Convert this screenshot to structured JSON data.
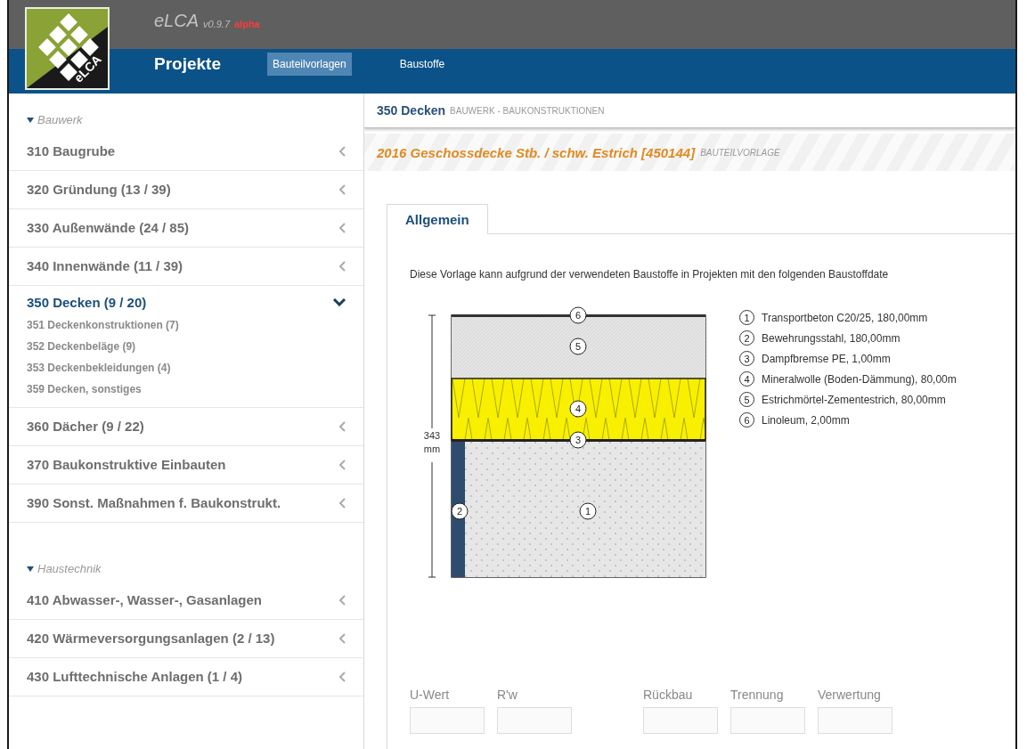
{
  "app": {
    "logo_text": "eLCA",
    "name": "eLCA",
    "version": "v0.9.7",
    "stage": "alpha"
  },
  "nav": {
    "title": "Projekte",
    "tabs": [
      {
        "label": "Bauteilvorlagen",
        "selected": true
      },
      {
        "label": "Baustoffe",
        "selected": false
      }
    ]
  },
  "sidebar": {
    "groups": [
      {
        "title": "Bauwerk",
        "expanded": true,
        "items": [
          {
            "label": "310 Baugrube",
            "expanded": false
          },
          {
            "label": "320 Gründung (13 / 39)",
            "expanded": false
          },
          {
            "label": "330 Außenwände (24 / 85)",
            "expanded": false
          },
          {
            "label": "340 Innenwände (11 / 39)",
            "expanded": false
          },
          {
            "label": "350 Decken (9 / 20)",
            "expanded": true,
            "children": [
              {
                "label": "351 Deckenkonstruktionen (7)"
              },
              {
                "label": "352 Deckenbeläge (9)"
              },
              {
                "label": "353 Deckenbekleidungen (4)"
              },
              {
                "label": "359 Decken, sonstiges"
              }
            ]
          },
          {
            "label": "360 Dächer (9 / 22)",
            "expanded": false
          },
          {
            "label": "370 Baukonstruktive Einbauten",
            "expanded": false
          },
          {
            "label": "390 Sonst. Maßnahmen f. Baukonstrukt.",
            "expanded": false
          }
        ]
      },
      {
        "title": "Haustechnik",
        "expanded": true,
        "items": [
          {
            "label": "410 Abwasser-, Wasser-, Gasanlagen",
            "expanded": false
          },
          {
            "label": "420 Wärmeversorgungsanlagen (2 / 13)",
            "expanded": false
          },
          {
            "label": "430 Lufttechnische Anlagen (1 / 4)",
            "expanded": false
          }
        ]
      }
    ]
  },
  "breadcrumb": {
    "title": "350 Decken",
    "path": "BAUWERK - BAUKONSTRUKTIONEN"
  },
  "element": {
    "title": "2016 Geschossdecke Stb. / schw. Estrich [450144]",
    "type": "BAUTEILVORLAGE"
  },
  "tabs": [
    {
      "label": "Allgemein",
      "selected": true
    }
  ],
  "notice": "Diese Vorlage kann aufgrund der verwendeten Baustoffe in Projekten mit den folgenden Baustoffdate",
  "diagram": {
    "height_value": "343",
    "height_unit": "mm",
    "layers": [
      {
        "kind": "linoleum",
        "mark": "6"
      },
      {
        "kind": "screed",
        "mark": "5"
      },
      {
        "kind": "insulation",
        "mark": "4"
      },
      {
        "kind": "foil",
        "mark": "3"
      },
      {
        "kind": "concrete",
        "mark": "1"
      },
      {
        "kind": "rebar",
        "mark": "2"
      }
    ]
  },
  "legend": [
    {
      "number": "1",
      "text": "Transportbeton C20/25, 180,00mm"
    },
    {
      "number": "2",
      "text": "Bewehrungsstahl, 180,00mm"
    },
    {
      "number": "3",
      "text": "Dampfbremse PE, 1,00mm"
    },
    {
      "number": "4",
      "text": "Mineralwolle (Boden-Dämmung), 80,00m"
    },
    {
      "number": "5",
      "text": "Estrichmörtel-Zementestrich, 80,00mm"
    },
    {
      "number": "6",
      "text": "Linoleum, 2,00mm"
    }
  ],
  "field_groups": [
    [
      {
        "label": "U-Wert"
      },
      {
        "label": "R'w"
      }
    ],
    [
      {
        "label": "Rückbau"
      },
      {
        "label": "Trennung"
      },
      {
        "label": "Verwertung"
      }
    ]
  ]
}
